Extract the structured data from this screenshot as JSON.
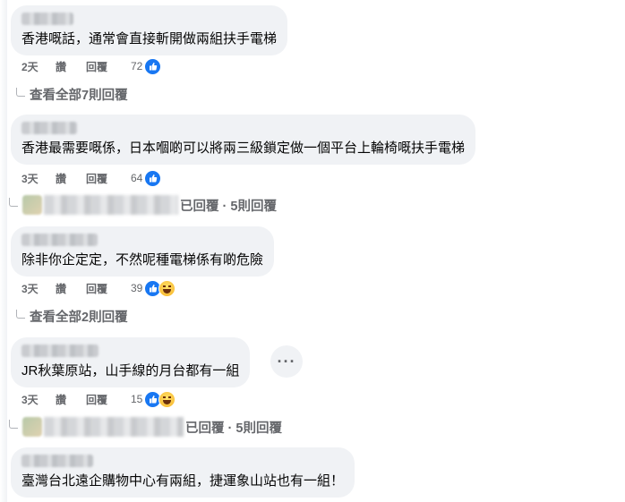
{
  "comments": [
    {
      "text": "香港嘅話，通常會直接斬開做兩組扶手電梯",
      "time": "2天",
      "like": "讚",
      "reply": "回覆",
      "count": "72",
      "reactions": [
        "like-icon"
      ]
    },
    {
      "text": "香港最需要嘅係，日本嗰啲可以將兩三級鎖定做一個平台上輪椅嘅扶手電梯",
      "time": "3天",
      "like": "讚",
      "reply": "回覆",
      "count": "64",
      "reactions": [
        "like-icon"
      ]
    },
    {
      "text": "除非你企定定，不然呢種電梯係有啲危險",
      "time": "3天",
      "like": "讚",
      "reply": "回覆",
      "count": "39",
      "reactions": [
        "like-icon",
        "haha-icon"
      ]
    },
    {
      "text": "JR秋葉原站，山手線的月台都有一組",
      "time": "3天",
      "like": "讚",
      "reply": "回覆",
      "count": "15",
      "reactions": [
        "like-icon",
        "haha-icon"
      ]
    },
    {
      "text": "臺灣台北遠企購物中心有兩組，捷運象山站也有一組！"
    }
  ],
  "view_all_1": "查看全部7則回覆",
  "view_all_2": "查看全部2則回覆",
  "replied_1": "已回覆 · 5則回覆",
  "replied_2": "已回覆 · 5則回覆",
  "more_button": "···",
  "colors": {
    "bubble": "#f0f2f5",
    "meta": "#65676b",
    "like": "#1877f2"
  }
}
